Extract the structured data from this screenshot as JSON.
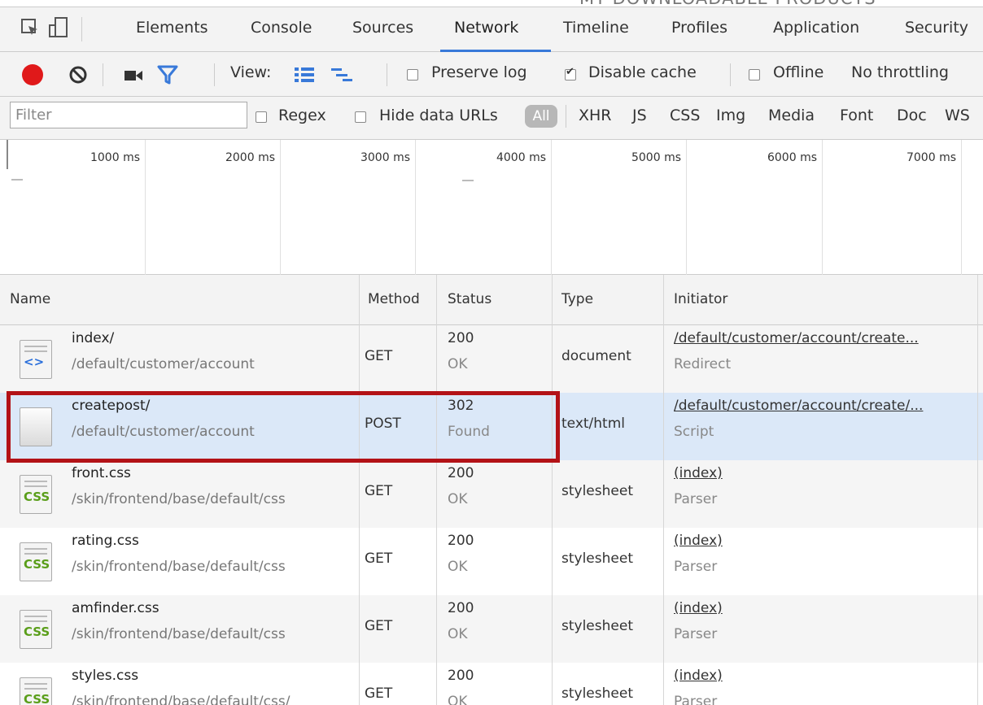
{
  "page_header_cut": "MY DOWNLOADABLE PRODUCTS",
  "tabs": [
    "Elements",
    "Console",
    "Sources",
    "Network",
    "Timeline",
    "Profiles",
    "Application",
    "Security"
  ],
  "active_tab": "Network",
  "toolbar": {
    "view_label": "View:",
    "preserve_log": "Preserve log",
    "disable_cache": "Disable cache",
    "offline": "Offline",
    "throttling": "No throttling",
    "record_color": "#e0191a"
  },
  "filterbar": {
    "filter_placeholder": "Filter",
    "regex": "Regex",
    "hide_data_urls": "Hide data URLs",
    "all": "All",
    "types": [
      "XHR",
      "JS",
      "CSS",
      "Img",
      "Media",
      "Font",
      "Doc",
      "WS"
    ]
  },
  "overview": {
    "ticks": [
      "1000 ms",
      "2000 ms",
      "3000 ms",
      "4000 ms",
      "5000 ms",
      "6000 ms",
      "7000 ms"
    ]
  },
  "table": {
    "headers": {
      "name": "Name",
      "method": "Method",
      "status": "Status",
      "type": "Type",
      "initiator": "Initiator"
    },
    "rows": [
      {
        "name": "index/",
        "path": "/default/customer/account",
        "method": "GET",
        "code": "200",
        "status_text": "OK",
        "type": "document",
        "initiator": "/default/customer/account/create...",
        "initiator_type": "Redirect",
        "icon": "html-document-icon"
      },
      {
        "name": "createpost/",
        "path": "/default/customer/account",
        "method": "POST",
        "code": "302",
        "status_text": "Found",
        "type": "text/html",
        "initiator": "/default/customer/account/create/...",
        "initiator_type": "Script",
        "icon": "blank-file-icon"
      },
      {
        "name": "front.css",
        "path": "/skin/frontend/base/default/css",
        "method": "GET",
        "code": "200",
        "status_text": "OK",
        "type": "stylesheet",
        "initiator": "(index)",
        "initiator_type": "Parser",
        "icon": "css-file-icon"
      },
      {
        "name": "rating.css",
        "path": "/skin/frontend/base/default/css",
        "method": "GET",
        "code": "200",
        "status_text": "OK",
        "type": "stylesheet",
        "initiator": "(index)",
        "initiator_type": "Parser",
        "icon": "css-file-icon"
      },
      {
        "name": "amfinder.css",
        "path": "/skin/frontend/base/default/css",
        "method": "GET",
        "code": "200",
        "status_text": "OK",
        "type": "stylesheet",
        "initiator": "(index)",
        "initiator_type": "Parser",
        "icon": "css-file-icon"
      },
      {
        "name": "styles.css",
        "path": "/skin/frontend/base/default/css/",
        "method": "GET",
        "code": "200",
        "status_text": "OK",
        "type": "stylesheet",
        "initiator": "(index)",
        "initiator_type": "Parser",
        "icon": "css-file-icon"
      }
    ]
  },
  "highlight_color": "#b31217"
}
